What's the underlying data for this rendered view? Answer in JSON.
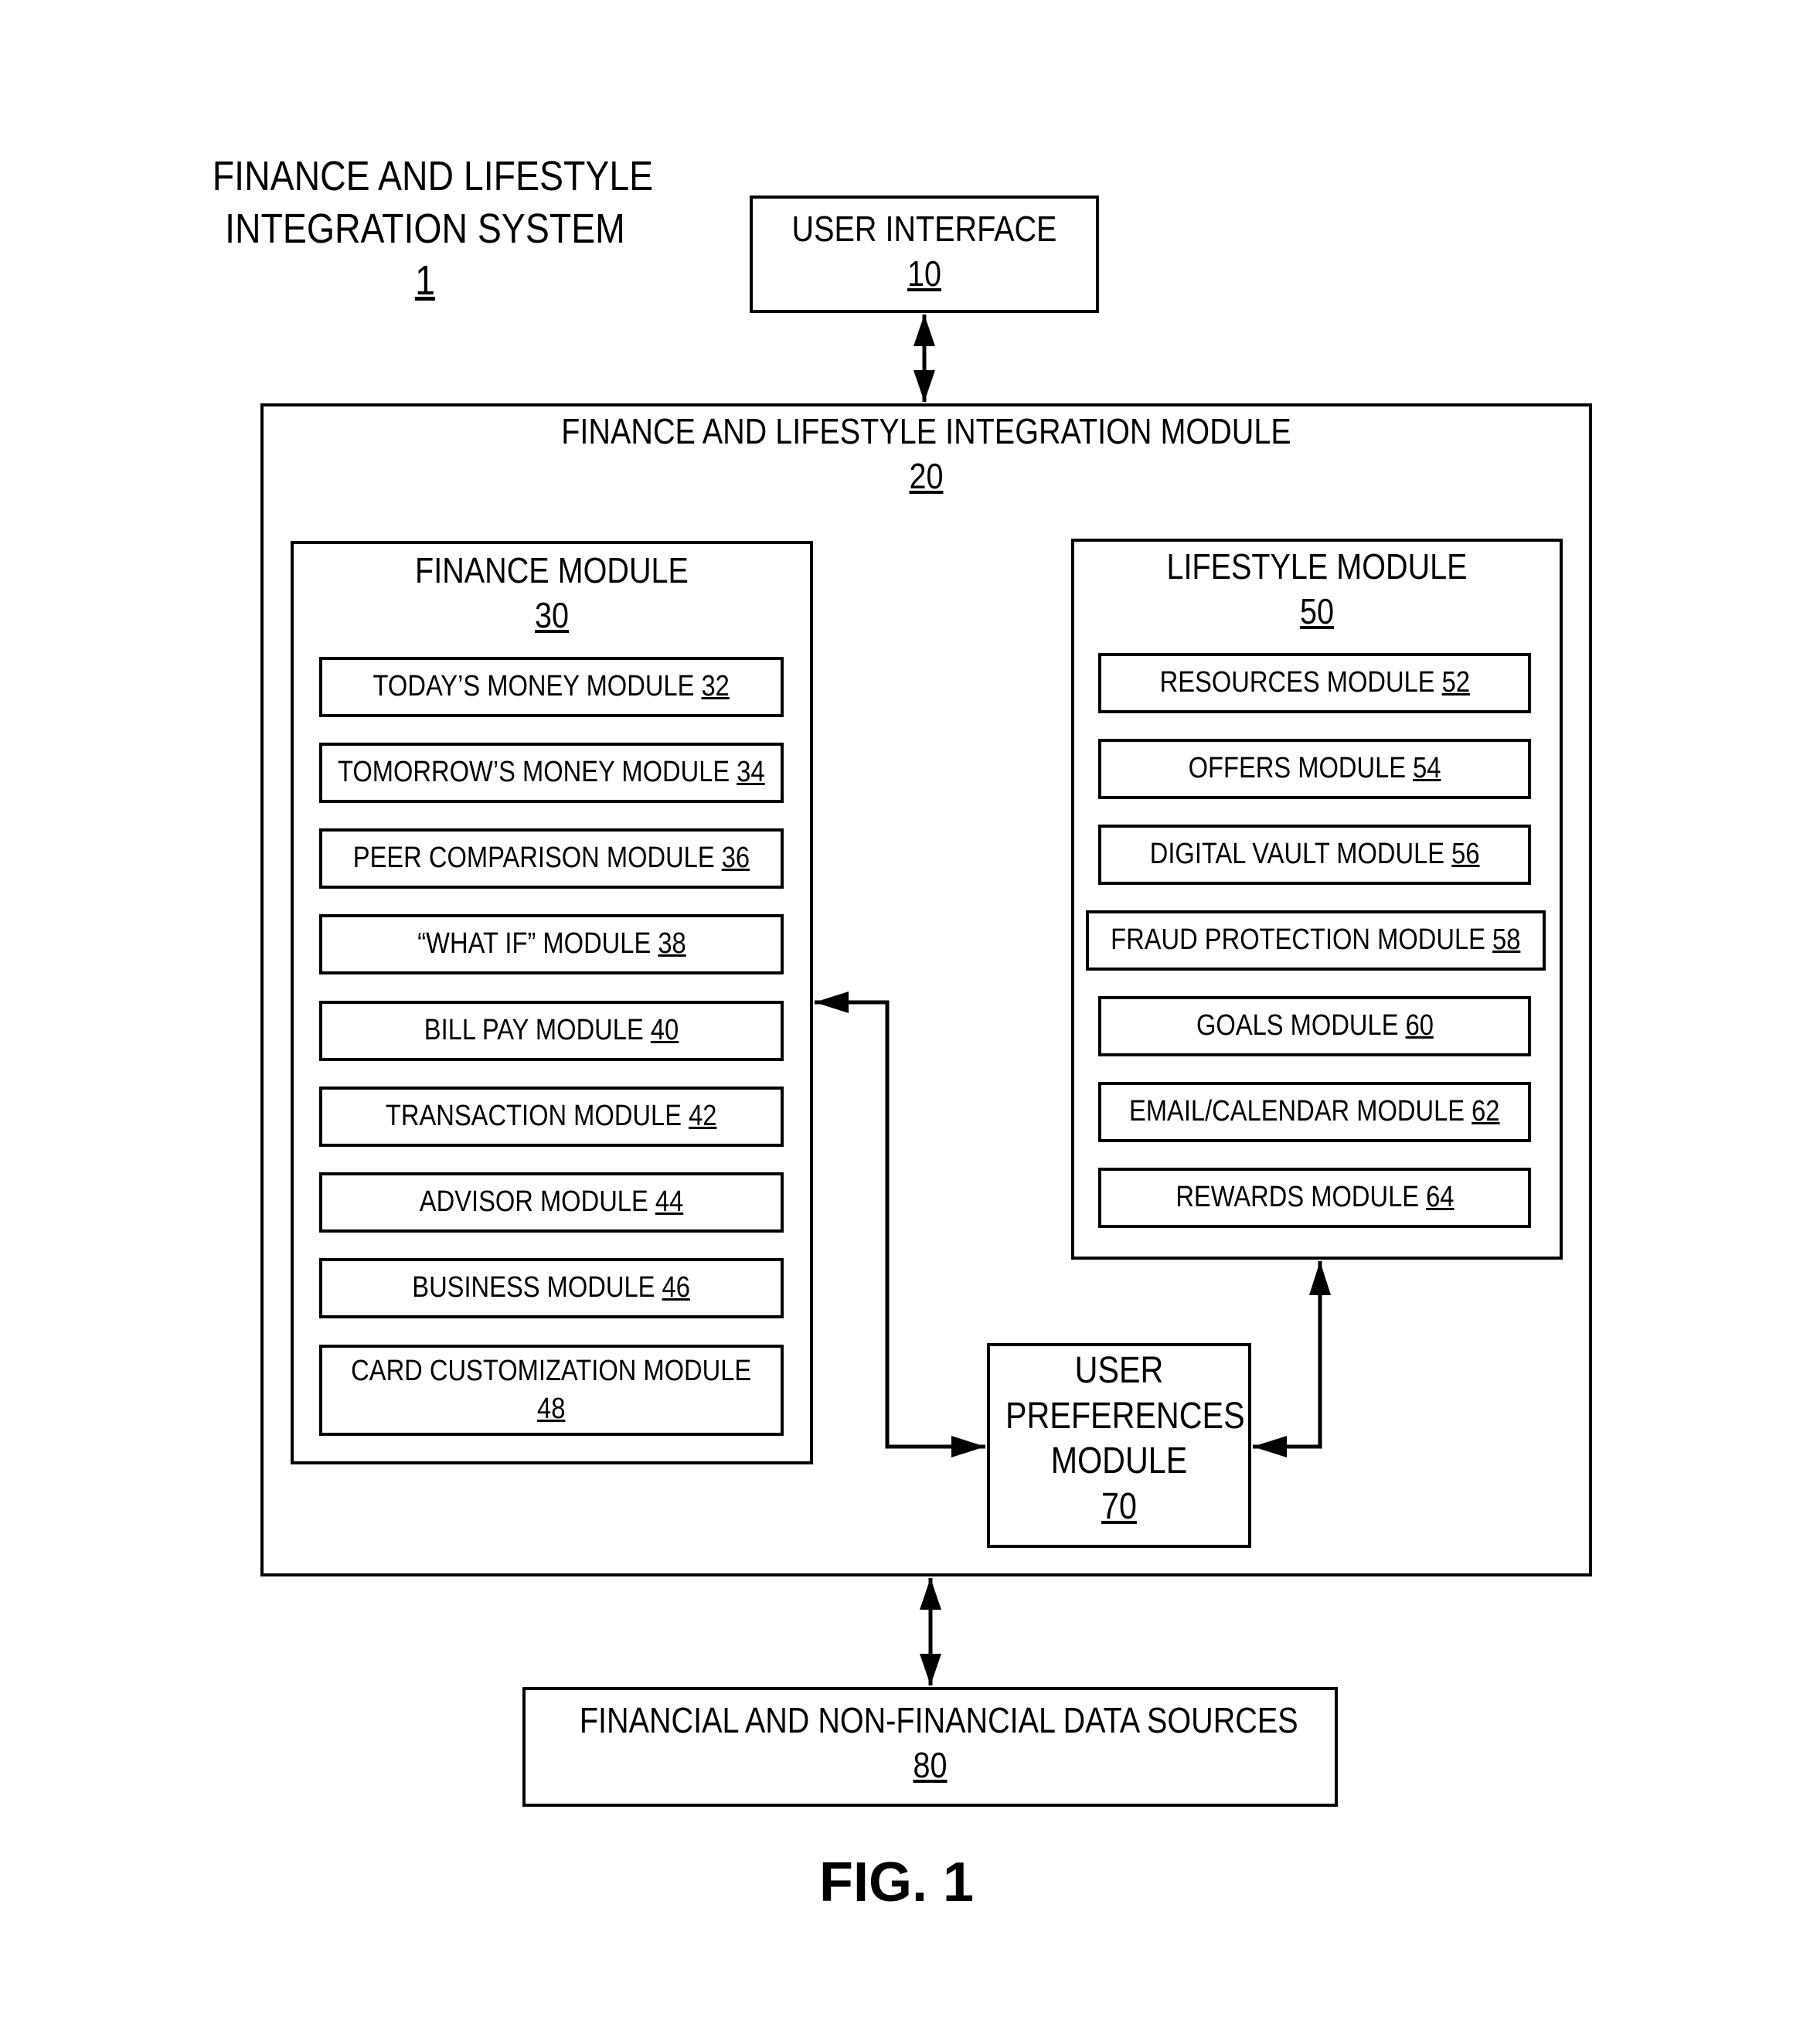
{
  "system": {
    "title_line1": "FINANCE AND LIFESTYLE",
    "title_line2": "INTEGRATION SYSTEM",
    "ref": "1"
  },
  "user_interface": {
    "label": "USER INTERFACE",
    "ref": "10"
  },
  "integration_module": {
    "label": "FINANCE AND LIFESTYLE INTEGRATION MODULE",
    "ref": "20"
  },
  "finance_module": {
    "label": "FINANCE MODULE",
    "ref": "30",
    "items": [
      {
        "label": "TODAY’S MONEY MODULE",
        "ref": "32"
      },
      {
        "label": "TOMORROW’S MONEY MODULE",
        "ref": "34"
      },
      {
        "label": "PEER COMPARISON MODULE",
        "ref": "36"
      },
      {
        "label": "“WHAT IF” MODULE",
        "ref": "38"
      },
      {
        "label": "BILL PAY MODULE",
        "ref": "40"
      },
      {
        "label": "TRANSACTION MODULE",
        "ref": "42"
      },
      {
        "label": "ADVISOR MODULE",
        "ref": "44"
      },
      {
        "label": "BUSINESS MODULE",
        "ref": "46"
      },
      {
        "label": "CARD CUSTOMIZATION MODULE",
        "ref": "48"
      }
    ]
  },
  "lifestyle_module": {
    "label": "LIFESTYLE MODULE",
    "ref": "50",
    "items": [
      {
        "label": "RESOURCES MODULE",
        "ref": "52"
      },
      {
        "label": "OFFERS MODULE",
        "ref": "54"
      },
      {
        "label": "DIGITAL VAULT MODULE",
        "ref": "56"
      },
      {
        "label": "FRAUD PROTECTION MODULE",
        "ref": "58"
      },
      {
        "label": "GOALS MODULE",
        "ref": "60"
      },
      {
        "label": "EMAIL/CALENDAR MODULE",
        "ref": "62"
      },
      {
        "label": "REWARDS MODULE",
        "ref": "64"
      }
    ]
  },
  "user_preferences": {
    "line1": "USER",
    "line2": "PREFERENCES",
    "line3": "MODULE",
    "ref": "70"
  },
  "data_sources": {
    "label": "FINANCIAL AND NON-FINANCIAL DATA SOURCES",
    "ref": "80"
  },
  "figure_label": "FIG. 1"
}
